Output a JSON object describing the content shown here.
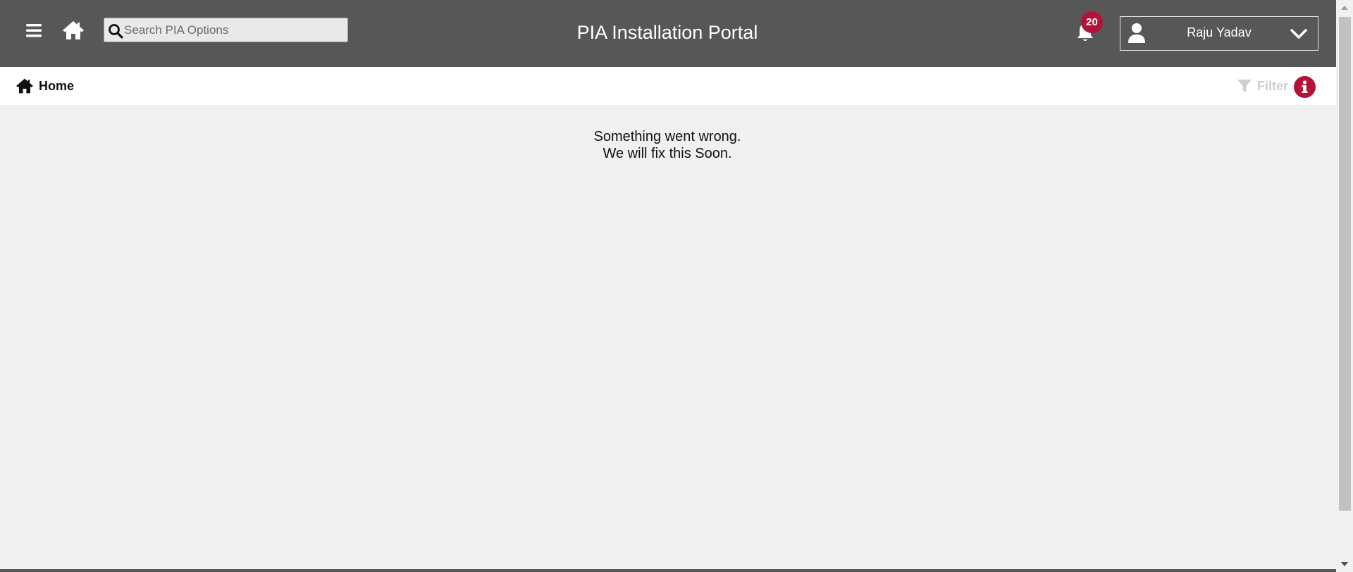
{
  "header": {
    "title": "PIA Installation Portal",
    "search_placeholder": "Search PIA Options",
    "search_value": "",
    "notification_count": "20",
    "user_name": "Raju Yadav",
    "icons": {
      "menu": "hamburger-menu-icon",
      "home": "home-icon",
      "search": "search-icon",
      "bell": "bell-icon",
      "user": "user-icon",
      "dropdown": "chevron-down-icon"
    }
  },
  "breadcrumb": {
    "home_label": "Home"
  },
  "toolbar": {
    "filter_label": "Filter",
    "info_icon": "info-icon"
  },
  "main": {
    "error_line1": "Something went wrong.",
    "error_line2": "We will fix this Soon."
  },
  "colors": {
    "header_bg": "#575757",
    "accent": "#b5123a",
    "content_bg": "#f0f0f0",
    "filter_disabled": "#cfcfcf"
  }
}
